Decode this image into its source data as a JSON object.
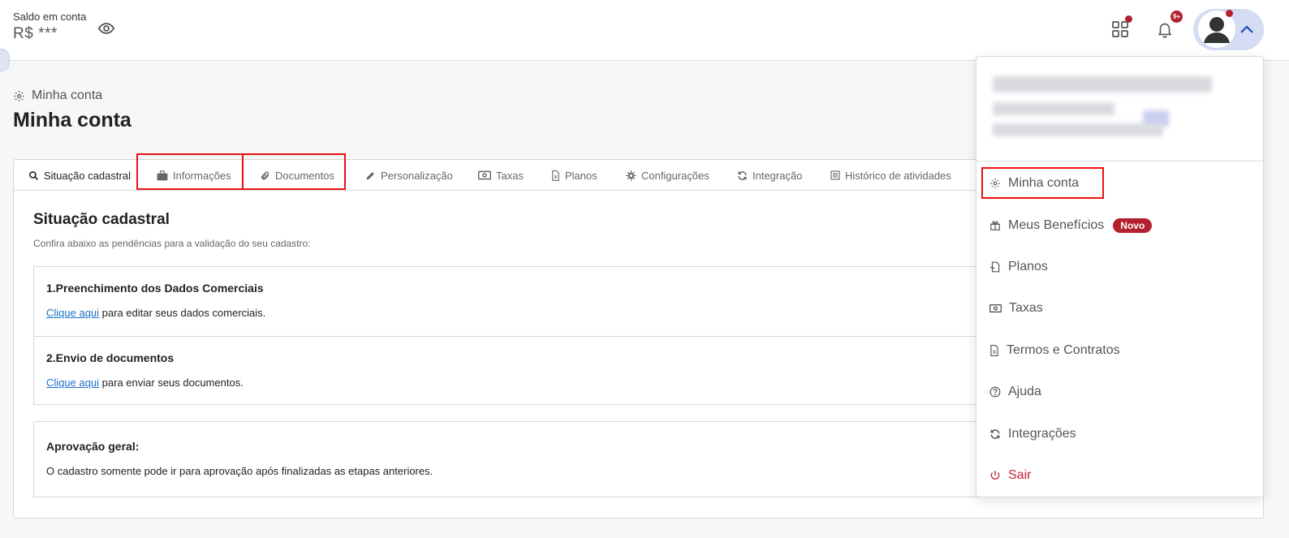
{
  "header": {
    "balance_label": "Saldo em conta",
    "balance_value": "R$ ***",
    "notifications_count": "9+"
  },
  "page": {
    "breadcrumb": "Minha conta",
    "title": "Minha conta"
  },
  "tabs": [
    {
      "label": "Situação cadastral",
      "icon": "search-icon",
      "active": true
    },
    {
      "label": "Informações",
      "icon": "briefcase-icon"
    },
    {
      "label": "Documentos",
      "icon": "paperclip-icon"
    },
    {
      "label": "Personalização",
      "icon": "pencil-icon"
    },
    {
      "label": "Taxas",
      "icon": "money-icon"
    },
    {
      "label": "Planos",
      "icon": "document-icon"
    },
    {
      "label": "Configurações",
      "icon": "gear-icon"
    },
    {
      "label": "Integração",
      "icon": "refresh-icon"
    },
    {
      "label": "Histórico de atividades",
      "icon": "list-icon"
    }
  ],
  "section": {
    "title": "Situação cadastral",
    "subtitle": "Confira abaixo as pendências para a validação do seu cadastro:"
  },
  "steps": [
    {
      "title": "1.Preenchimento dos Dados Comerciais",
      "link": "Clique aqui",
      "text": " para editar seus dados comerciais."
    },
    {
      "title": "2.Envio de documentos",
      "link": "Clique aqui",
      "text": " para enviar seus documentos."
    }
  ],
  "approval": {
    "title": "Aprovação geral:",
    "text": "O cadastro somente pode ir para aprovação após finalizadas as etapas anteriores."
  },
  "menu": {
    "items": [
      {
        "label": "Minha conta",
        "icon": "gear-icon"
      },
      {
        "label": "Meus Benefícios",
        "icon": "gift-icon",
        "badge": "Novo"
      },
      {
        "label": "Planos",
        "icon": "plan-icon"
      },
      {
        "label": "Taxas",
        "icon": "money-icon"
      },
      {
        "label": "Termos e Contratos",
        "icon": "document-icon"
      },
      {
        "label": "Ajuda",
        "icon": "help-icon"
      },
      {
        "label": "Integrações",
        "icon": "refresh-icon"
      },
      {
        "label": "Sair",
        "icon": "power-icon"
      }
    ]
  },
  "colors": {
    "accent_red": "#b3202e",
    "link_blue": "#1a73c8",
    "highlight": "#ee1111",
    "avatar_pill": "#d4dbf2"
  }
}
